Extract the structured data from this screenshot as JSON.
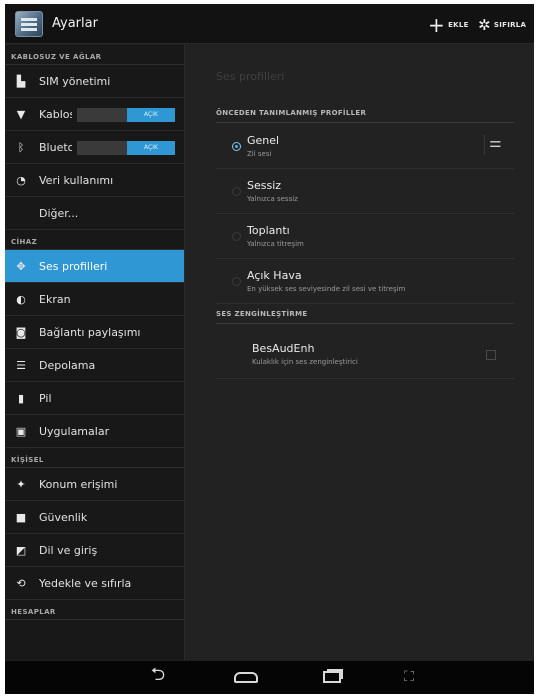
{
  "app": {
    "title": "Ayarlar"
  },
  "actionbar": {
    "add_label": "EKLE",
    "reset_label": "SIFIRLA"
  },
  "sidebar": {
    "sections": {
      "wireless": "KABLOSUZ VE AĞLAR",
      "device": "CİHAZ",
      "personal": "KİŞİSEL",
      "accounts": "HESAPLAR"
    },
    "items": {
      "sim": "SIM yönetimi",
      "wifi": "Kablosuz",
      "wifi_toggle": "AÇIK",
      "bluetooth": "Bluetooth",
      "bluetooth_toggle": "AÇIK",
      "data_usage": "Veri kullanımı",
      "more": "Diğer...",
      "sound_profiles": "Ses profilleri",
      "display": "Ekran",
      "tethering": "Bağlantı paylaşımı",
      "storage": "Depolama",
      "battery": "Pil",
      "apps": "Uygulamalar",
      "location": "Konum erişimi",
      "security": "Güvenlik",
      "language": "Dil ve giriş",
      "backup": "Yedekle ve sıfırla"
    },
    "active": "sound_profiles"
  },
  "content": {
    "heading": "Ses profilleri",
    "predefined_header": "ÖNCEDEN TANIMLANMIŞ PROFİLLER",
    "profiles": [
      {
        "name": "Genel",
        "desc": "Zil sesi",
        "selected": true
      },
      {
        "name": "Sessiz",
        "desc": "Yalnızca sessiz",
        "selected": false
      },
      {
        "name": "Toplantı",
        "desc": "Yalnızca titreşim",
        "selected": false
      },
      {
        "name": "Açık Hava",
        "desc": "En yüksek ses seviyesinde zil sesi ve titreşim",
        "selected": false
      }
    ],
    "enhancement_header": "SES ZENGİNLEŞTİRME",
    "enhancement": {
      "title": "BesAudEnh",
      "desc": "Kulaklık için ses zenginleştirici",
      "checked": false
    }
  },
  "icons": {
    "add": "plus-icon",
    "reset": "gear-icon",
    "back": "back-icon",
    "home": "home-icon",
    "recent": "recent-apps-icon",
    "screenshot": "screenshot-icon",
    "tune": "equalizer-icon"
  },
  "colors": {
    "accent": "#2f97d3",
    "background": "#1f1f1f"
  }
}
